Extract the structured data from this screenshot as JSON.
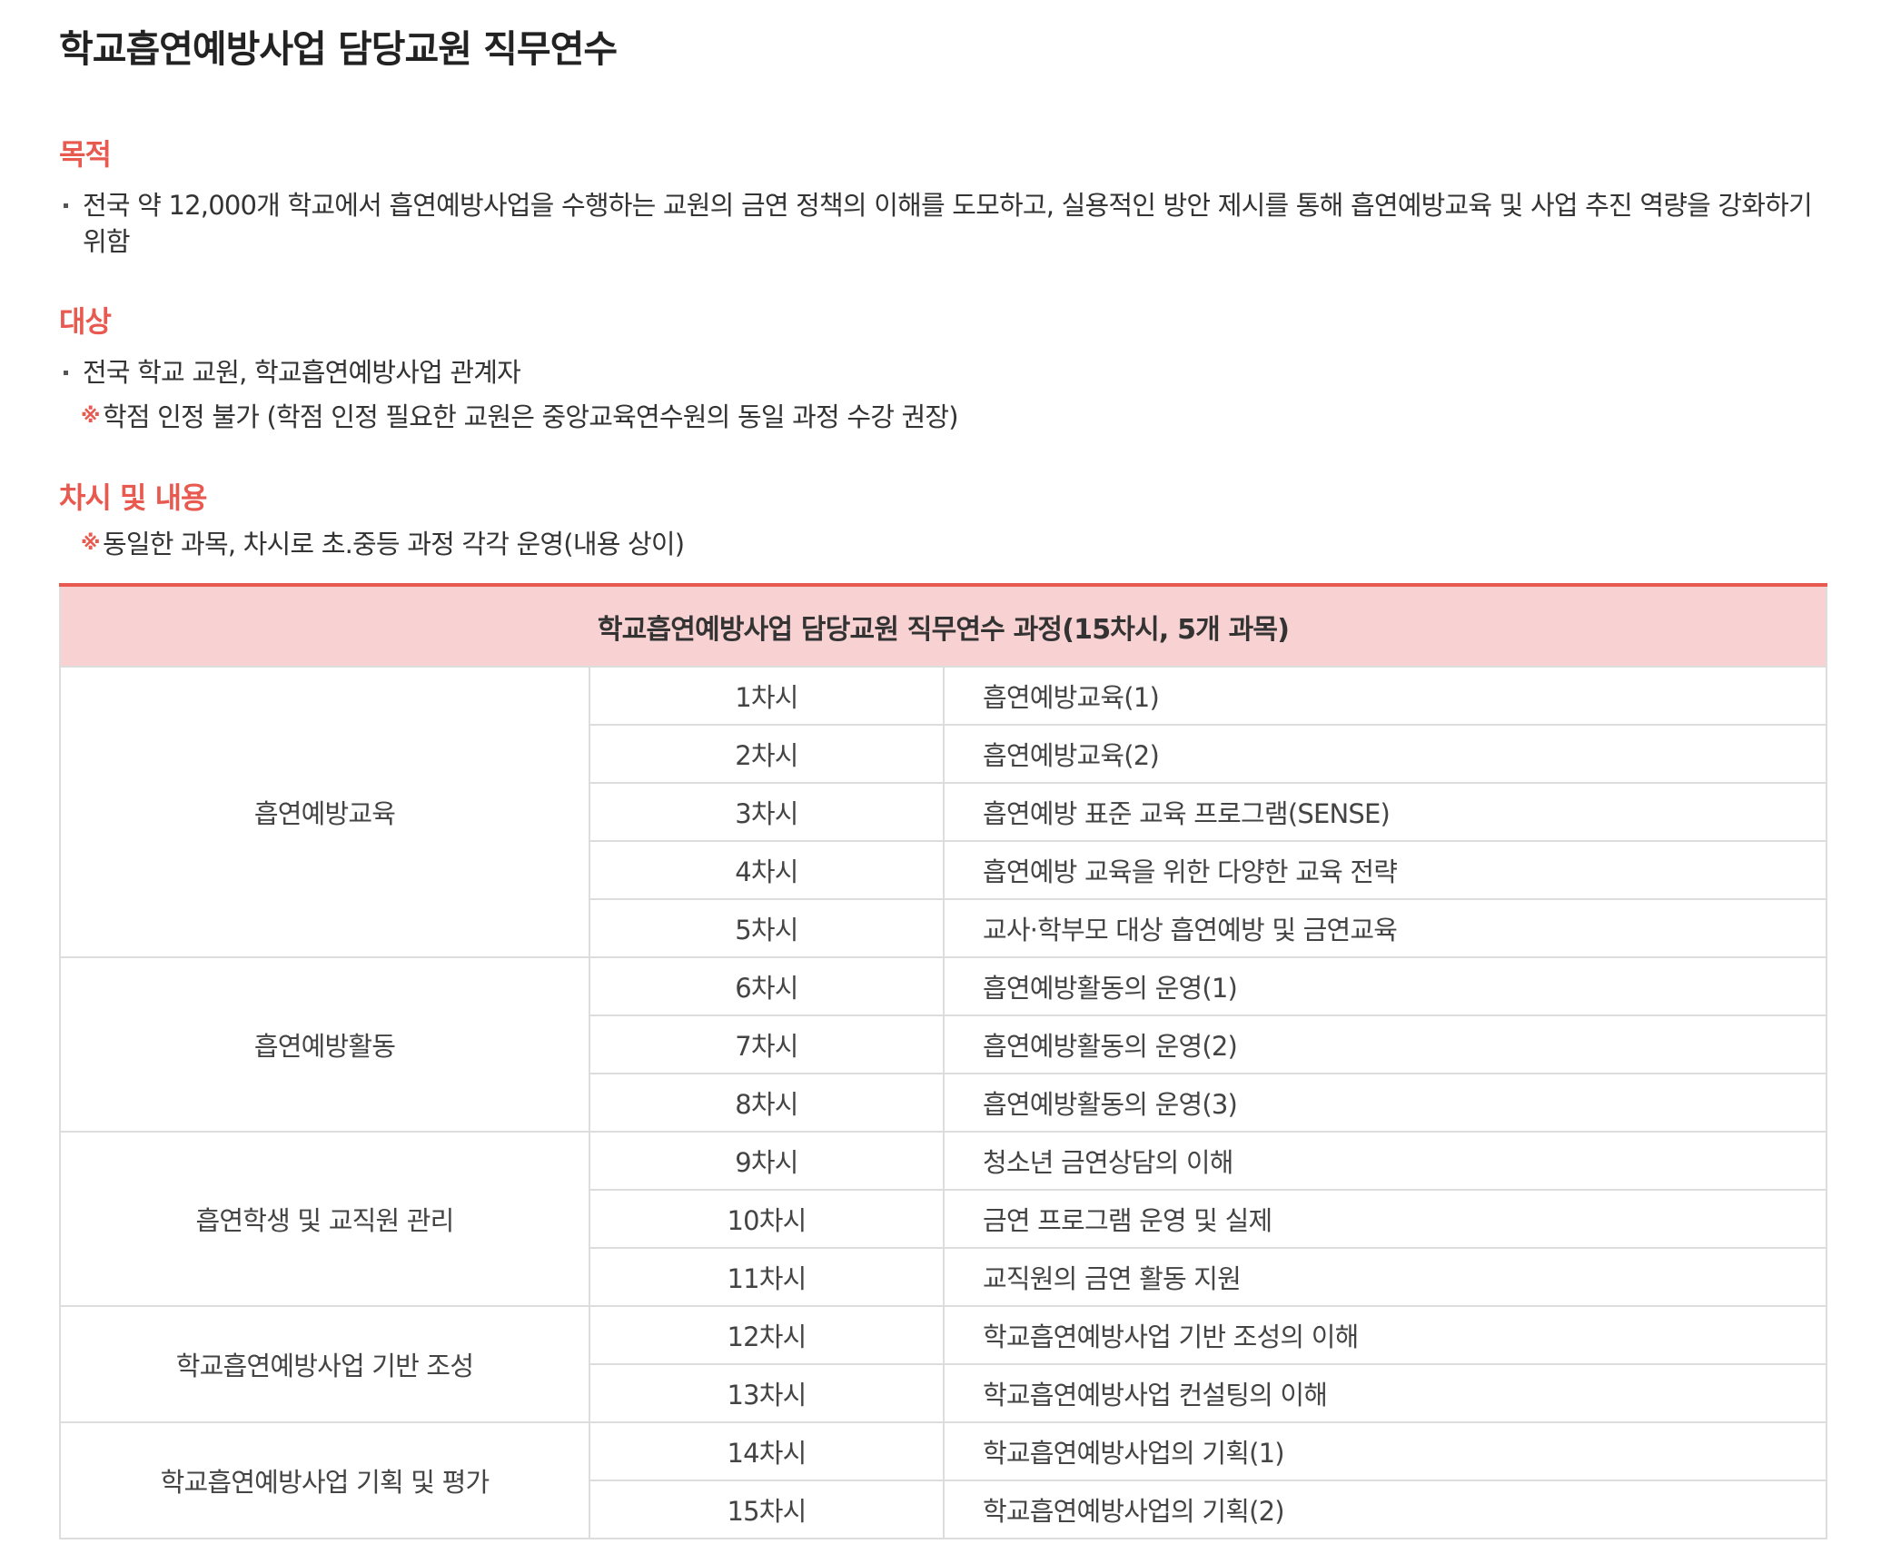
{
  "title": "학교흡연예방사업 담당교원 직무연수",
  "purpose": {
    "heading": "목적",
    "bullet": "전국 약 12,000개 학교에서 흡연예방사업을 수행하는 교원의 금연 정책의 이해를 도모하고, 실용적인 방안 제시를 통해 흡연예방교육 및 사업 추진 역량을 강화하기 위함"
  },
  "target": {
    "heading": "대상",
    "bullet": "전국 학교 교원, 학교흡연예방사업 관계자",
    "note_mark": "※",
    "note": "학점 인정 불가 (학점 인정 필요한 교원은 중앙교육연수원의 동일 과정 수강 권장)"
  },
  "sessions": {
    "heading": "차시 및 내용",
    "note_mark": "※",
    "note": "동일한 과목, 차시로 초.중등 과정 각각 운영(내용 상이)"
  },
  "table": {
    "caption": "학교흡연예방사업 담당교원 직무연수 과정(15차시, 5개 과목)",
    "groups": [
      {
        "subject": "흡연예방교육",
        "rows": [
          {
            "session": "1차시",
            "content": "흡연예방교육(1)"
          },
          {
            "session": "2차시",
            "content": "흡연예방교육(2)"
          },
          {
            "session": "3차시",
            "content": "흡연예방 표준 교육 프로그램(SENSE)"
          },
          {
            "session": "4차시",
            "content": "흡연예방 교육을 위한 다양한 교육 전략"
          },
          {
            "session": "5차시",
            "content": "교사·학부모 대상 흡연예방 및 금연교육"
          }
        ]
      },
      {
        "subject": "흡연예방활동",
        "rows": [
          {
            "session": "6차시",
            "content": "흡연예방활동의 운영(1)"
          },
          {
            "session": "7차시",
            "content": "흡연예방활동의 운영(2)"
          },
          {
            "session": "8차시",
            "content": "흡연예방활동의 운영(3)"
          }
        ]
      },
      {
        "subject": "흡연학생 및 교직원 관리",
        "rows": [
          {
            "session": "9차시",
            "content": "청소년 금연상담의 이해"
          },
          {
            "session": "10차시",
            "content": "금연 프로그램 운영 및 실제"
          },
          {
            "session": "11차시",
            "content": "교직원의 금연 활동 지원"
          }
        ]
      },
      {
        "subject": "학교흡연예방사업 기반 조성",
        "rows": [
          {
            "session": "12차시",
            "content": "학교흡연예방사업 기반 조성의 이해"
          },
          {
            "session": "13차시",
            "content": "학교흡연예방사업 컨설팅의 이해"
          }
        ]
      },
      {
        "subject": "학교흡연예방사업 기획 및 평가",
        "rows": [
          {
            "session": "14차시",
            "content": "학교흡연예방사업의 기획(1)"
          },
          {
            "session": "15차시",
            "content": "학교흡연예방사업의 기획(2)"
          }
        ]
      }
    ]
  }
}
